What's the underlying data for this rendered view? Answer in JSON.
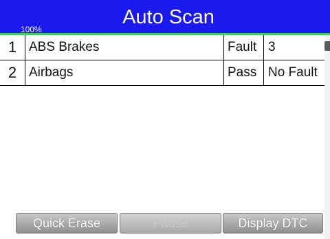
{
  "header": {
    "title": "Auto Scan",
    "progress_label": "100%",
    "bg_color": "#1a1aee",
    "accent_color": "#3ed05a"
  },
  "results": [
    {
      "num": "1",
      "system": "ABS Brakes",
      "status": "Fault",
      "value": "3"
    },
    {
      "num": "2",
      "system": "Airbags",
      "status": "Pass",
      "value": "No Fault"
    }
  ],
  "buttons": {
    "quick_erase": "Quick Erase",
    "pause": "Pause",
    "display_dtc": "Display DTC"
  },
  "icons": {
    "scroll_thumb": "scrollbar-thumb"
  }
}
